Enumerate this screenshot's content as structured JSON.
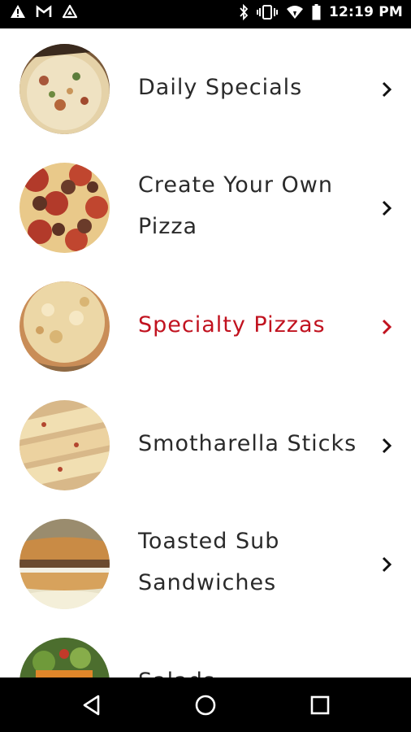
{
  "status_bar": {
    "time": "12:19 PM",
    "left_icons": [
      "warning-icon",
      "gmail-icon",
      "drive-icon"
    ],
    "right_icons": [
      "bluetooth-icon",
      "vibrate-icon",
      "wifi-icon",
      "battery-icon"
    ]
  },
  "menu": {
    "accent_color": "#c1121f",
    "items": [
      {
        "label_lines": [
          "Daily Specials"
        ],
        "active": false,
        "image": "pizza-thumbnail"
      },
      {
        "label_lines": [
          "Create Your Own",
          "Pizza"
        ],
        "active": false,
        "image": "pepperoni-sausage-pizza-thumbnail"
      },
      {
        "label_lines": [
          "Specialty Pizzas"
        ],
        "active": true,
        "image": "cheese-pizza-thumbnail"
      },
      {
        "label_lines": [
          "Smotharella Sticks"
        ],
        "active": false,
        "image": "cheese-sticks-thumbnail"
      },
      {
        "label_lines": [
          "Toasted Sub",
          "Sandwiches"
        ],
        "active": false,
        "image": "sub-sandwich-thumbnail"
      },
      {
        "label_lines": [
          "Salads"
        ],
        "active": false,
        "image": "salad-thumbnail"
      }
    ]
  },
  "nav_bar": {
    "buttons": [
      "back-icon",
      "home-icon",
      "recents-icon"
    ]
  }
}
